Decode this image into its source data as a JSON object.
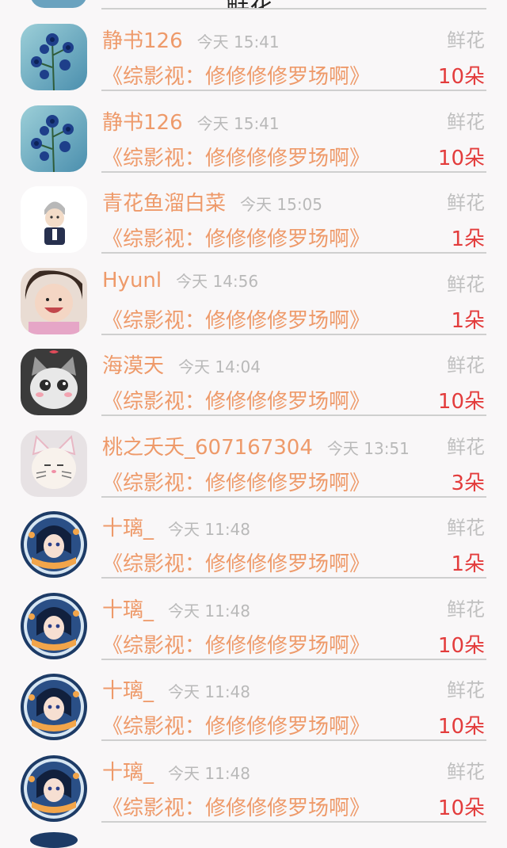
{
  "header": {
    "title": "鲜花"
  },
  "icons": {
    "blue_flowers": "blue-flowers-avatar-icon",
    "cartoon_man": "cartoon-man-avatar-icon",
    "baby": "baby-avatar-icon",
    "cat": "cat-avatar-icon",
    "cat_filter": "cat-filter-avatar-icon",
    "anime_badge": "anime-badge-avatar-icon"
  },
  "colors": {
    "name": "#ee9a6a",
    "count": "#e33c3c",
    "muted": "#b9b9b9",
    "divider": "#cfcfcf",
    "background": "#f9f7f8"
  },
  "gifts": [
    {
      "user": "静书126",
      "time": "今天 15:41",
      "type": "鲜花",
      "book": "《综影视：修修修修罗场啊》",
      "count": "10朵",
      "avatar": "blue_flowers"
    },
    {
      "user": "静书126",
      "time": "今天 15:41",
      "type": "鲜花",
      "book": "《综影视：修修修修罗场啊》",
      "count": "10朵",
      "avatar": "blue_flowers"
    },
    {
      "user": "青花鱼溜白菜",
      "time": "今天 15:05",
      "type": "鲜花",
      "book": "《综影视：修修修修罗场啊》",
      "count": "1朵",
      "avatar": "cartoon_man"
    },
    {
      "user": "Hyunl",
      "time": "今天 14:56",
      "type": "鲜花",
      "book": "《综影视：修修修修罗场啊》",
      "count": "1朵",
      "avatar": "baby"
    },
    {
      "user": "海漠天",
      "time": "今天 14:04",
      "type": "鲜花",
      "book": "《综影视：修修修修罗场啊》",
      "count": "10朵",
      "avatar": "cat"
    },
    {
      "user": "桃之夭夭_607167304",
      "time": "今天 13:51",
      "type": "鲜花",
      "book": "《综影视：修修修修罗场啊》",
      "count": "3朵",
      "avatar": "cat_filter"
    },
    {
      "user": "十璃_",
      "time": "今天 11:48",
      "type": "鲜花",
      "book": "《综影视：修修修修罗场啊》",
      "count": "1朵",
      "avatar": "anime_badge"
    },
    {
      "user": "十璃_",
      "time": "今天 11:48",
      "type": "鲜花",
      "book": "《综影视：修修修修罗场啊》",
      "count": "10朵",
      "avatar": "anime_badge"
    },
    {
      "user": "十璃_",
      "time": "今天 11:48",
      "type": "鲜花",
      "book": "《综影视：修修修修罗场啊》",
      "count": "10朵",
      "avatar": "anime_badge"
    },
    {
      "user": "十璃_",
      "time": "今天 11:48",
      "type": "鲜花",
      "book": "《综影视：修修修修罗场啊》",
      "count": "10朵",
      "avatar": "anime_badge"
    }
  ]
}
